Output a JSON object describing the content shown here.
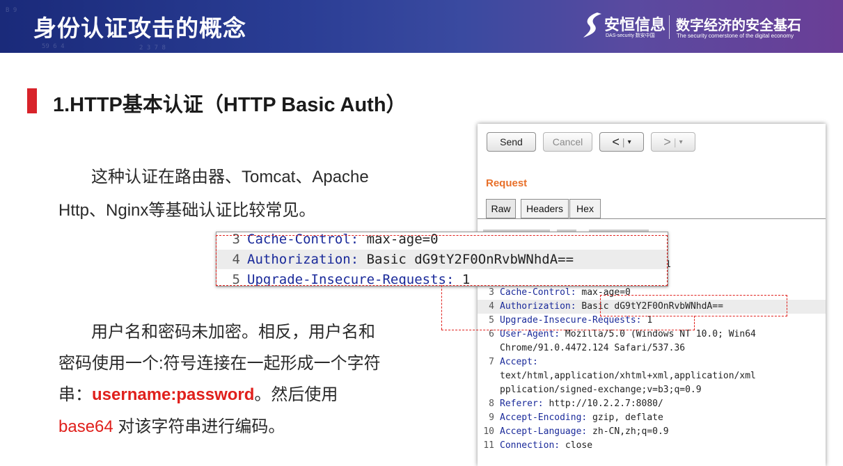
{
  "header": {
    "title": "身份认证攻击的概念",
    "logo_cn": "安恒信息",
    "logo_en": "DAS-security 数安中国",
    "slogan": "数字经济的安全基石",
    "slogan_en": "The security cornerstone of the digital economy"
  },
  "section": {
    "title": "1.HTTP基本认证（HTTP Basic Auth）"
  },
  "paragraphs": {
    "p1_line1": "这种认证在路由器、Tomcat、Apache",
    "p1_line2": "Http、Nginx等基础认证比较常见。",
    "p2_line1": "用户名和密码未加密。相反，用户名和",
    "p2_line2": "密码使用一个:符号连接在一起形成一个字符",
    "p2_line3_pre": "串：",
    "p2_line3_highlight": "username:password",
    "p2_line3_post": "。然后使用",
    "p2_line4_highlight": "base64",
    "p2_line4_post": " 对该字符串进行编码。"
  },
  "burp": {
    "send_label": "Send",
    "cancel_label": "Cancel",
    "back_label": "<",
    "fwd_label": ">",
    "dropdown_glyph": "▾",
    "request_label": "Request",
    "tabs": [
      "Raw",
      "Headers",
      "Hex"
    ],
    "partial_line": "1",
    "lines": [
      {
        "n": "3",
        "key": "Cache-Control:",
        "val": " max-age=0"
      },
      {
        "n": "4",
        "key": "Authorization:",
        "val": " Basic dG9tY2F0OnRvbWNhdA=="
      },
      {
        "n": "5",
        "key": "Upgrade-Insecure-Requests:",
        "val": " 1"
      },
      {
        "n": "6",
        "key": "User-Agent:",
        "val": " Mozilla/5.0 (Windows NT 10.0; Win64"
      },
      {
        "n": "",
        "key": "",
        "val": "Chrome/91.0.4472.124 Safari/537.36"
      },
      {
        "n": "7",
        "key": "Accept:",
        "val": ""
      },
      {
        "n": "",
        "key": "",
        "val": "text/html,application/xhtml+xml,application/xml"
      },
      {
        "n": "",
        "key": "",
        "val": "pplication/signed-exchange;v=b3;q=0.9"
      },
      {
        "n": "8",
        "key": "Referer:",
        "val": " http://10.2.2.7:8080/"
      },
      {
        "n": "9",
        "key": "Accept-Encoding:",
        "val": " gzip, deflate"
      },
      {
        "n": "10",
        "key": "Accept-Language:",
        "val": " zh-CN,zh;q=0.9"
      },
      {
        "n": "11",
        "key": "Connection:",
        "val": " close"
      }
    ]
  },
  "zoom": {
    "lines": [
      {
        "n": "3",
        "key": "Cache-Control:",
        "val": " max-age=0"
      },
      {
        "n": "4",
        "key": "Authorization:",
        "val": " Basic dG9tY2F0OnRvbWNhdA=="
      },
      {
        "n": "5",
        "key": "Upgrade-Insecure-Requests:",
        "val": " 1"
      }
    ]
  },
  "colors": {
    "accent_red": "#e0201c",
    "section_bar": "#d8232a",
    "request_orange": "#e8702a",
    "header_key_blue": "#1a2a9a"
  }
}
